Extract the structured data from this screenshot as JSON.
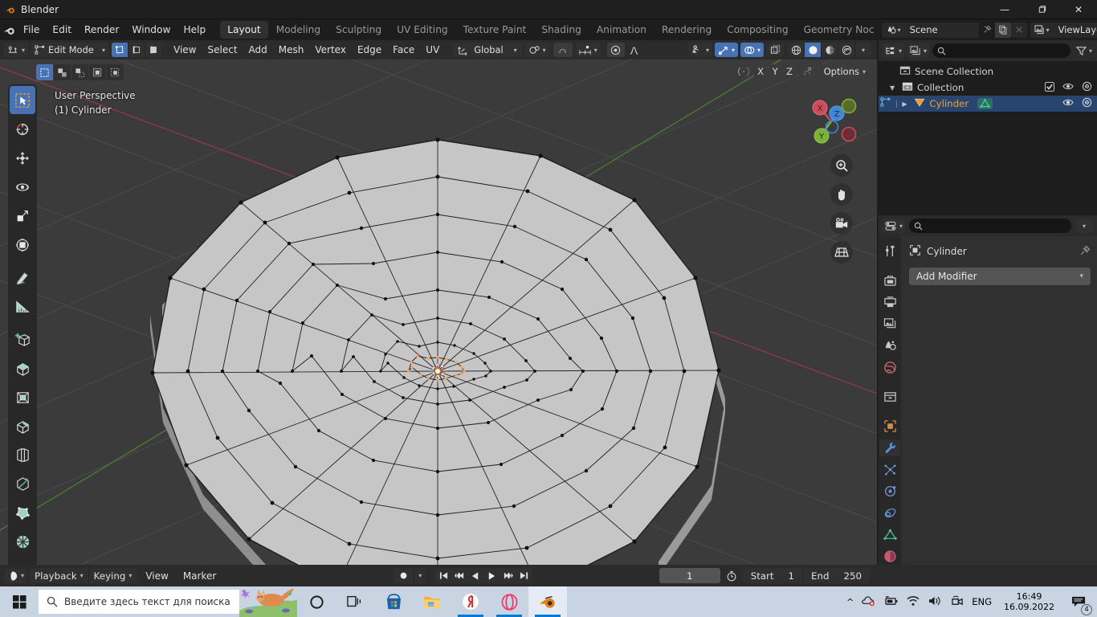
{
  "window": {
    "title": "Blender",
    "minimize": "—",
    "maximize": "❐",
    "close": "✕"
  },
  "topbar": {
    "menus": [
      "File",
      "Edit",
      "Render",
      "Window",
      "Help"
    ],
    "workspace_tabs": [
      {
        "label": "Layout",
        "active": true
      },
      {
        "label": "Modeling",
        "active": false
      },
      {
        "label": "Sculpting",
        "active": false
      },
      {
        "label": "UV Editing",
        "active": false
      },
      {
        "label": "Texture Paint",
        "active": false
      },
      {
        "label": "Shading",
        "active": false
      },
      {
        "label": "Animation",
        "active": false
      },
      {
        "label": "Rendering",
        "active": false
      },
      {
        "label": "Compositing",
        "active": false
      },
      {
        "label": "Geometry Noc",
        "active": false
      }
    ],
    "scene_name": "Scene",
    "viewlayer_name": "ViewLayer"
  },
  "viewport_header": {
    "mode": "Edit Mode",
    "menus": [
      "View",
      "Select",
      "Add",
      "Mesh",
      "Vertex",
      "Edge",
      "Face",
      "UV"
    ],
    "transform_orientation": "Global"
  },
  "viewport": {
    "overlay_line1": "User Perspective",
    "overlay_line2": "(1) Cylinder",
    "proportional_label": "",
    "axis_buttons": [
      "X",
      "Y",
      "Z"
    ],
    "options_label": "Options",
    "gizmo_axes": {
      "x": "X",
      "y": "Y",
      "z": "Z"
    },
    "tools": [
      "tweak-select-tool",
      "cursor-tool",
      "move-tool",
      "rotate-tool",
      "scale-tool",
      "transform-tool",
      "annotate-tool",
      "measure-tool",
      "add-cube-tool",
      "extrude-region-tool",
      "inset-faces-tool",
      "bevel-tool",
      "loop-cut-tool",
      "knife-tool",
      "poly-build-tool",
      "spin-tool",
      "smooth-tool"
    ],
    "nav_buttons": [
      "zoom-icon",
      "pan-hand-icon",
      "camera-icon",
      "ortho-grid-icon"
    ]
  },
  "outliner": {
    "search_placeholder": "",
    "rows": [
      {
        "label": "Scene Collection",
        "indent": 0,
        "kind": "scene-collection",
        "selected": false,
        "has_disclosure": false,
        "checkbox": false,
        "eye": false,
        "camera": false
      },
      {
        "label": "Collection",
        "indent": 1,
        "kind": "collection",
        "selected": false,
        "has_disclosure": true,
        "checkbox": true,
        "eye": true,
        "camera": true
      },
      {
        "label": "Cylinder",
        "indent": 2,
        "kind": "mesh-object",
        "selected": true,
        "has_disclosure": true,
        "checkbox": false,
        "eye": true,
        "camera": true
      }
    ]
  },
  "properties": {
    "search_placeholder": "",
    "breadcrumb_object": "Cylinder",
    "add_modifier_label": "Add Modifier",
    "tabs": [
      {
        "name": "tool-tab",
        "color": "#d6d6d6",
        "active": false
      },
      {
        "name": "render-tab",
        "color": "#c8c8c8",
        "active": false
      },
      {
        "name": "output-tab",
        "color": "#c8c8c8",
        "active": false
      },
      {
        "name": "view-layer-tab",
        "color": "#c8c8c8",
        "active": false
      },
      {
        "name": "scene-tab",
        "color": "#c8c8c8",
        "active": false
      },
      {
        "name": "world-tab",
        "color": "#d46a6a",
        "active": false
      },
      {
        "name": "collection-tab",
        "color": "#c8c8c8",
        "active": false
      },
      {
        "name": "object-tab",
        "color": "#e08a3c",
        "active": false
      },
      {
        "name": "modifier-tab",
        "color": "#5b8fd6",
        "active": true
      },
      {
        "name": "particles-tab",
        "color": "#6f97d4",
        "active": false
      },
      {
        "name": "physics-tab",
        "color": "#6f97d4",
        "active": false
      },
      {
        "name": "constraints-tab",
        "color": "#6f97d4",
        "active": false
      },
      {
        "name": "data-tab",
        "color": "#4bbf91",
        "active": false
      },
      {
        "name": "material-tab",
        "color": "#c9576b",
        "active": false
      }
    ]
  },
  "timeline": {
    "menus": [
      "Playback",
      "Keying",
      "View",
      "Marker"
    ],
    "current_frame": "1",
    "start_label": "Start",
    "start_value": "1",
    "end_label": "End",
    "end_value": "250"
  },
  "taskbar": {
    "search_placeholder": "Введите здесь текст для поиска",
    "apps": [
      {
        "name": "cortana-icon",
        "running": false,
        "active": false
      },
      {
        "name": "task-view-icon",
        "running": false,
        "active": false
      },
      {
        "name": "microsoft-store-icon",
        "running": false,
        "active": false
      },
      {
        "name": "file-explorer-icon",
        "running": false,
        "active": false
      },
      {
        "name": "yandex-browser-icon",
        "running": true,
        "active": false
      },
      {
        "name": "opera-icon",
        "running": true,
        "active": false
      },
      {
        "name": "blender-icon",
        "running": true,
        "active": true
      }
    ],
    "language": "ENG",
    "time": "16:49",
    "date": "16.09.2022",
    "notification_count": "4"
  },
  "colors": {
    "accent_blue": "#4772b3",
    "blender_orange": "#e87d0d",
    "viewport_bg": "#3b3b3b",
    "panel_bg": "#303030",
    "header_bg": "#2b2b2b",
    "selected_row": "#28456f"
  }
}
